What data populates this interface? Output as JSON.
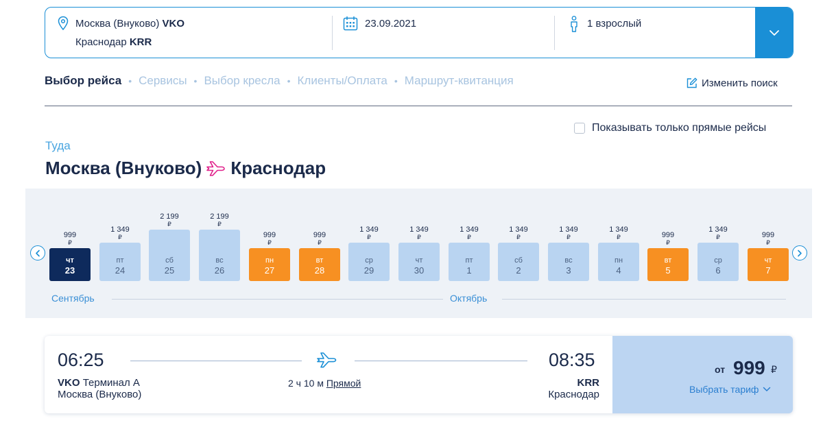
{
  "search": {
    "from_city": "Москва (Внуково)",
    "from_code": "VKO",
    "to_city": "Краснодар",
    "to_code": "KRR",
    "date": "23.09.2021",
    "passengers": "1 взрослый"
  },
  "steps": [
    {
      "label": "Выбор рейса",
      "active": true
    },
    {
      "label": "Сервисы",
      "active": false
    },
    {
      "label": "Выбор кресла",
      "active": false
    },
    {
      "label": "Клиенты/Оплата",
      "active": false
    },
    {
      "label": "Маршрут-квитанция",
      "active": false
    }
  ],
  "edit_search_label": "Изменить поиск",
  "direct_only_label": "Показывать только прямые рейсы",
  "direction_label": "Туда",
  "route_title": {
    "from": "Москва (Внуково)",
    "to": "Краснодар"
  },
  "calendar": {
    "currency": "₽",
    "months": [
      "Сентябрь",
      "Октябрь"
    ],
    "days": [
      {
        "dow": "чт",
        "num": "23",
        "price": "999",
        "state": "selected"
      },
      {
        "dow": "пт",
        "num": "24",
        "price": "1 349",
        "state": "normal"
      },
      {
        "dow": "сб",
        "num": "25",
        "price": "2 199",
        "state": "normal"
      },
      {
        "dow": "вс",
        "num": "26",
        "price": "2 199",
        "state": "normal"
      },
      {
        "dow": "пн",
        "num": "27",
        "price": "999",
        "state": "cheap"
      },
      {
        "dow": "вт",
        "num": "28",
        "price": "999",
        "state": "cheap"
      },
      {
        "dow": "ср",
        "num": "29",
        "price": "1 349",
        "state": "normal"
      },
      {
        "dow": "чт",
        "num": "30",
        "price": "1 349",
        "state": "normal"
      },
      {
        "dow": "пт",
        "num": "1",
        "price": "1 349",
        "state": "normal"
      },
      {
        "dow": "сб",
        "num": "2",
        "price": "1 349",
        "state": "normal"
      },
      {
        "dow": "вс",
        "num": "3",
        "price": "1 349",
        "state": "normal"
      },
      {
        "dow": "пн",
        "num": "4",
        "price": "1 349",
        "state": "normal"
      },
      {
        "dow": "вт",
        "num": "5",
        "price": "999",
        "state": "cheap"
      },
      {
        "dow": "ср",
        "num": "6",
        "price": "1 349",
        "state": "normal"
      },
      {
        "dow": "чт",
        "num": "7",
        "price": "999",
        "state": "cheap"
      }
    ]
  },
  "flight": {
    "dep_time": "06:25",
    "arr_time": "08:35",
    "dep_code": "VKO",
    "dep_terminal": "Терминал А",
    "dep_city": "Москва (Внуково)",
    "arr_code": "KRR",
    "arr_city": "Краснодар",
    "duration": "2 ч 10 м",
    "flight_type": "Прямой",
    "price_prefix": "от",
    "price": "999",
    "currency": "₽",
    "choose_label": "Выбрать тариф"
  },
  "colors": {
    "accent": "#1a8fd6",
    "cheap": "#f79022",
    "selected": "#0e2a5c",
    "normal": "#b9d4f1",
    "plane_icon": "#e0208a"
  }
}
